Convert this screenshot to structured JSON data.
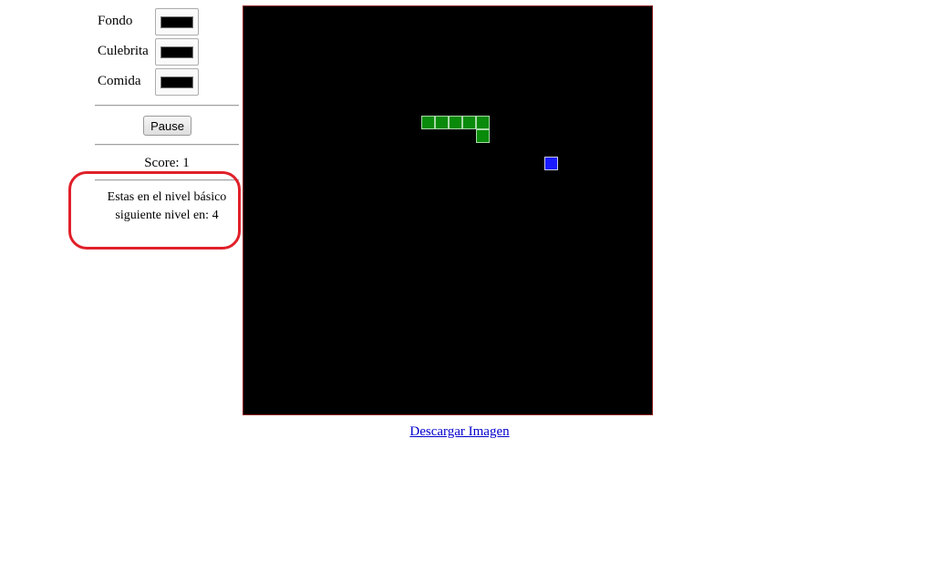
{
  "controls": {
    "colors": [
      {
        "label": "Fondo",
        "value": "#000000"
      },
      {
        "label": "Culebrita",
        "value": "#000000"
      },
      {
        "label": "Comida",
        "value": "#000000"
      }
    ],
    "pause_label": "Pause",
    "score_text": "Score: 1",
    "level_line1": "Estas en el nivel básico",
    "level_line2": "siguiente nivel en: 4"
  },
  "game": {
    "grid_cell": 15,
    "snake_color": "#0a8a0a",
    "food_color": "#1a1aff",
    "background_color": "#000000",
    "snake": [
      [
        13,
        8
      ],
      [
        14,
        8
      ],
      [
        15,
        8
      ],
      [
        16,
        8
      ],
      [
        17,
        8
      ],
      [
        17,
        9
      ]
    ],
    "food": [
      22,
      11
    ]
  },
  "download_label": "Descargar Imagen",
  "highlight_color": "#e0202a"
}
